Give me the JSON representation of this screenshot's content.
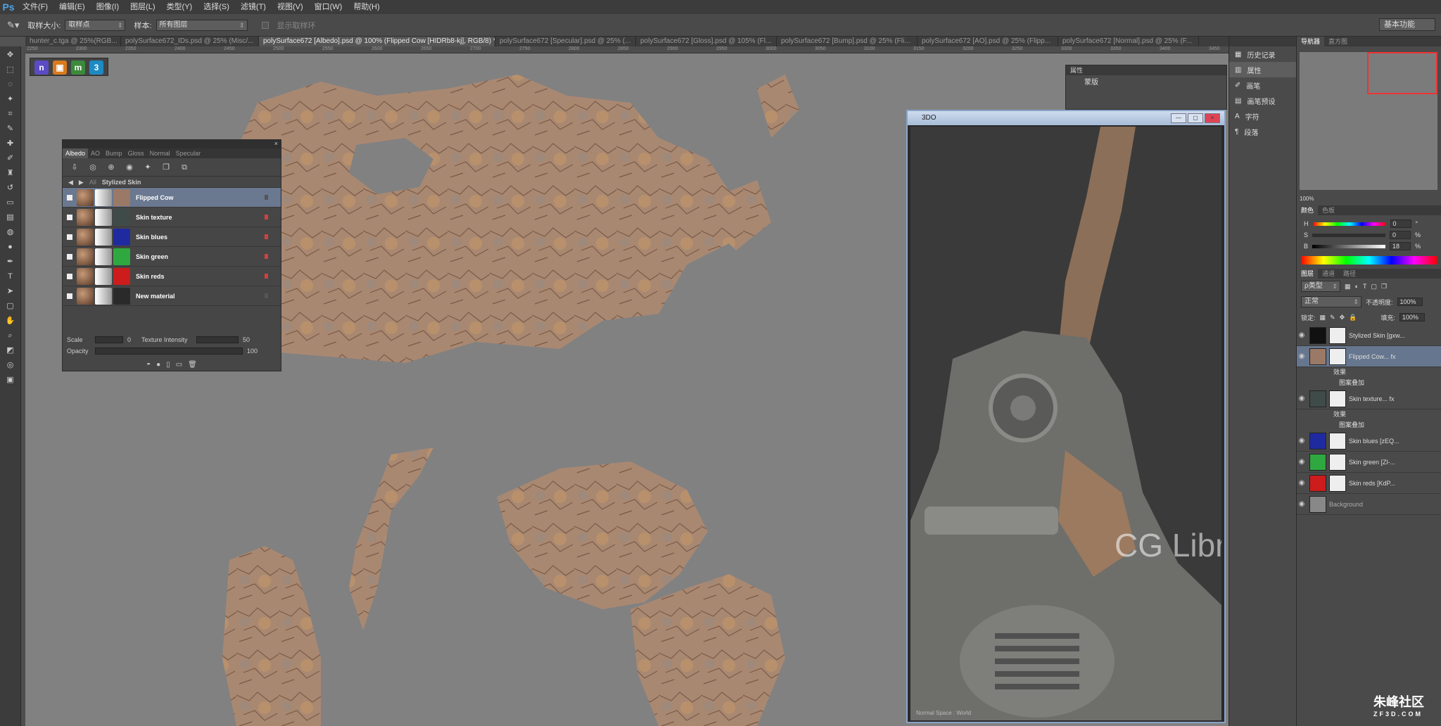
{
  "app": {
    "logo": "Ps"
  },
  "menu": [
    "文件(F)",
    "编辑(E)",
    "图像(I)",
    "图层(L)",
    "类型(Y)",
    "选择(S)",
    "滤镜(T)",
    "视图(V)",
    "窗口(W)",
    "帮助(H)"
  ],
  "options": {
    "sample_size_label": "取样大小:",
    "sample_size_value": "取样点",
    "sample_label": "样本:",
    "sample_value": "所有图层",
    "show_ring_label": "显示取样环",
    "workspace": "基本功能"
  },
  "tabs": [
    "hunter_c.tga @ 25%(RGB...",
    "polySurface672_IDs.psd @ 25% (Misc/...",
    "polySurface672 [Albedo].psd @ 100% (Flipped Cow [HIDRb8-kj], RGB/8) *",
    "polySurface672 [Specular].psd @ 25% (...",
    "polySurface672 [Gloss].psd @ 105% (Fl...",
    "polySurface672 [Bump].psd @ 25% (Fli...",
    "polySurface672 [AO].psd @ 25% (Flipp...",
    "polySurface672 [Normal].psd @ 25% (F..."
  ],
  "ruler_ticks": [
    "2250",
    "2300",
    "2350",
    "2400",
    "2450",
    "2500",
    "2550",
    "2600",
    "2650",
    "2700",
    "2750",
    "2800",
    "2850",
    "2900",
    "2950",
    "3000",
    "3050",
    "3100",
    "3150",
    "3200",
    "3250",
    "3300",
    "3350",
    "3400",
    "3450"
  ],
  "quixel": {
    "tabs": [
      "Albedo",
      "AO",
      "Bump",
      "Gloss",
      "Normal",
      "Specular"
    ],
    "crumb_all": "All",
    "crumb_folder": "Stylized Skin",
    "materials": [
      {
        "name": "Flipped Cow",
        "color": "#9a7a66",
        "flag": "#555"
      },
      {
        "name": "Skin texture",
        "color": "#3f4b48",
        "flag": "#d04040"
      },
      {
        "name": "Skin blues",
        "color": "#1f2aa0",
        "flag": "#d04040"
      },
      {
        "name": "Skin green",
        "color": "#2fa840",
        "flag": "#d04040"
      },
      {
        "name": "Skin reds",
        "color": "#cc1c1c",
        "flag": "#d04040"
      },
      {
        "name": "New material",
        "color": "#2a2a2a",
        "flag": "#555"
      }
    ],
    "scale_label": "Scale",
    "scale_value": "0",
    "intensity_label": "Texture Intensity",
    "intensity_value": "50",
    "opacity_label": "Opacity",
    "opacity_value": "100"
  },
  "viewer": {
    "title": "3DO",
    "watermark": "CG Library",
    "footer": "Normal Space : World"
  },
  "properties": {
    "head": "属性",
    "row": "蒙版"
  },
  "mini_panels": [
    "历史记录",
    "属性",
    "画笔",
    "画笔预设",
    "字符",
    "段落"
  ],
  "navigator": {
    "tabs": [
      "导航器",
      "直方图"
    ],
    "zoom": "100%"
  },
  "color": {
    "tabs": [
      "颜色",
      "色板"
    ],
    "rows": [
      {
        "l": "H",
        "v": "0"
      },
      {
        "l": "S",
        "v": "0"
      },
      {
        "l": "B",
        "v": "18"
      }
    ],
    "unit_h": "°",
    "unit_pct": "%"
  },
  "layers": {
    "tabs": [
      "图层",
      "通道",
      "路径"
    ],
    "kind": "ρ类型",
    "blend": "正常",
    "opacity_label": "不透明度:",
    "opacity": "100%",
    "lock_label": "锁定:",
    "fill_label": "填充:",
    "fill": "100%",
    "items": [
      {
        "name": "Stylized Skin [gxw...",
        "thumb": "#111",
        "sel": false
      },
      {
        "name": "Flipped Cow... fx",
        "thumb": "#9a7a66",
        "sel": true
      },
      {
        "name": "Skin texture... fx",
        "thumb": "#3f4b48",
        "sel": false
      },
      {
        "name": "Skin blues [zEQ...",
        "thumb": "#1f2aa0",
        "sel": false
      },
      {
        "name": "Skin green [Zl-...",
        "thumb": "#2fa840",
        "sel": false
      },
      {
        "name": "Skin reds [KdP...",
        "thumb": "#cc1c1c",
        "sel": false
      }
    ],
    "effects_label": "效果",
    "pattern_label": "图案叠加",
    "background": "Background"
  },
  "brand": {
    "name": "朱峰社区",
    "url": "ZF3D.COM"
  }
}
